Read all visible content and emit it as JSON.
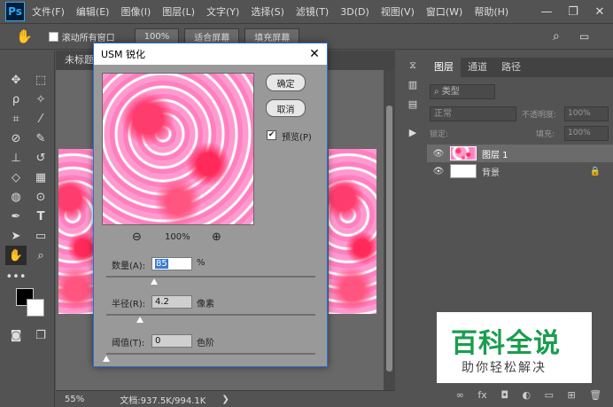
{
  "app": {
    "logo": "Ps"
  },
  "menu": [
    "文件(F)",
    "编辑(E)",
    "图像(I)",
    "图层(L)",
    "文字(Y)",
    "选择(S)",
    "滤镜(T)",
    "3D(D)",
    "视图(V)",
    "窗口(W)",
    "帮助(H)"
  ],
  "window_controls": {
    "minimize": "—",
    "restore": "❐",
    "close": "✕"
  },
  "options_bar": {
    "scroll_all_label": "滚动所有窗口",
    "zoom_100": "100%",
    "fit_screen": "适合屏幕",
    "fill_screen": "填充屏幕"
  },
  "document": {
    "tab_title": "未标题",
    "zoom": "55%",
    "doc_info": "文档:937.5K/994.1K"
  },
  "layers_panel": {
    "tabs": [
      "图层",
      "通道",
      "路径"
    ],
    "filter_kind": "类型",
    "blend_mode": "正常",
    "opacity_label": "不透明度:",
    "opacity_value": "100%",
    "lock_label": "锁定:",
    "fill_label": "填充:",
    "fill_value": "100%",
    "layers": [
      {
        "name": "图层 1"
      },
      {
        "name": "背景"
      }
    ]
  },
  "dialog": {
    "title": "USM 锐化",
    "ok": "确定",
    "cancel": "取消",
    "preview_label": "预览(P)",
    "preview_checked": true,
    "zoom_level": "100%",
    "amount_label": "数量(A):",
    "amount_value": "85",
    "amount_unit": "%",
    "amount_slider": 0.23,
    "radius_label": "半径(R):",
    "radius_value": "4.2",
    "radius_unit": "像素",
    "radius_slider": 0.16,
    "threshold_label": "阈值(T):",
    "threshold_value": "0",
    "threshold_unit": "色阶",
    "threshold_slider": 0.0
  },
  "watermark": {
    "main": "百科全说",
    "sub": "助你轻松解决"
  },
  "colors": {
    "accent": "#31a8ff",
    "dialog_border": "#2a6fd6",
    "watermark_green": "#1a9d4f"
  }
}
